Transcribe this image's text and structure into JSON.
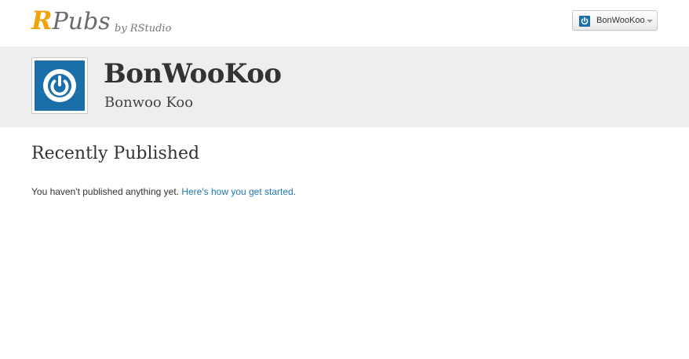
{
  "brand": {
    "logo_r": "R",
    "logo_pubs": "Pubs",
    "byline": "by RStudio",
    "logo_r_color": "#f0a30a"
  },
  "user_menu": {
    "username": "BonWooKoo",
    "icon": "power-icon",
    "dropdown_icon": "caret-down-icon"
  },
  "profile": {
    "avatar_icon": "power-icon",
    "avatar_color": "#1b6fa8",
    "username": "BonWooKoo",
    "full_name": "Bonwoo Koo"
  },
  "published": {
    "heading": "Recently Published",
    "empty_message": "You haven't published anything yet.",
    "get_started_link": "Here's how you get started.",
    "link_color": "#1f78b4"
  }
}
